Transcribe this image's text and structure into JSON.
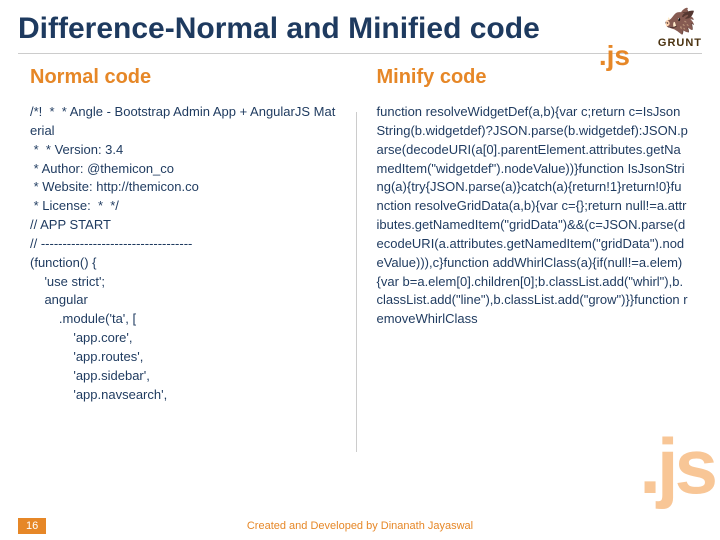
{
  "title": "Difference-Normal and Minified code",
  "logos": {
    "js_small": ".js",
    "grunt_label": "GRUNT",
    "warthog_emoji": "🐗"
  },
  "left": {
    "heading": "Normal code",
    "code": "/*!  *  * Angle - Bootstrap Admin App + AngularJS Material\n *  * Version: 3.4\n * Author: @themicon_co\n * Website: http://themicon.co\n * License:  *  */\n// APP START\n// -----------------------------------\n(function() {\n    'use strict';\n    angular\n        .module('ta', [\n            'app.core',\n            'app.routes',\n            'app.sidebar',\n            'app.navsearch',"
  },
  "right": {
    "heading": "Minify code",
    "code": "function resolveWidgetDef(a,b){var c;return c=IsJsonString(b.widgetdef)?JSON.parse(b.widgetdef):JSON.parse(decodeURI(a[0].parentElement.attributes.getNamedItem(\"widgetdef\").nodeValue))}function IsJsonString(a){try{JSON.parse(a)}catch(a){return!1}return!0}function resolveGridData(a,b){var c={};return null!=a.attributes.getNamedItem(\"gridData\")&&(c=JSON.parse(decodeURI(a.attributes.getNamedItem(\"gridData\").nodeValue))),c}function addWhirlClass(a){if(null!=a.elem){var b=a.elem[0].children[0];b.classList.add(\"whirl\"),b.classList.add(\"line\"),b.classList.add(\"grow\")}}function removeWhirlClass"
  },
  "footer": {
    "credit": "Created and Developed by Dinanath Jayaswal",
    "page": "16"
  },
  "watermark_js": ".js"
}
